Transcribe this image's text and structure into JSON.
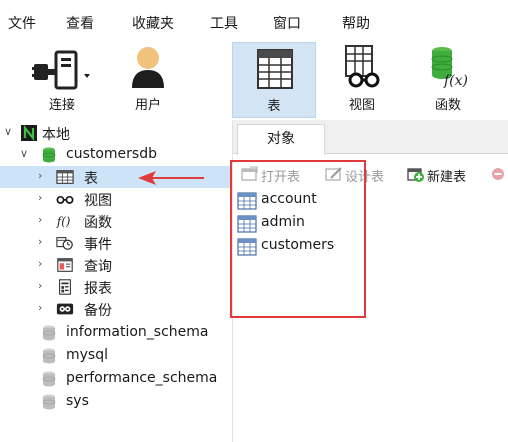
{
  "menu": {
    "items": [
      "文件",
      "查看",
      "收藏夹",
      "工具",
      "窗口",
      "帮助"
    ]
  },
  "toolbar": {
    "connect_label": "连接",
    "user_label": "用户",
    "table_label": "表",
    "view_label": "视图",
    "function_label": "函数",
    "function_icon_text": "f(x)"
  },
  "tree": {
    "root_label": "本地",
    "database_label": "customersdb",
    "children": [
      "表",
      "视图",
      "函数",
      "事件",
      "查询",
      "报表",
      "备份"
    ],
    "other_databases": [
      "information_schema",
      "mysql",
      "performance_schema",
      "sys"
    ]
  },
  "object_panel": {
    "tab_label": "对象",
    "actions": {
      "open_table": "打开表",
      "design_table": "设计表",
      "new_table": "新建表"
    },
    "tables": [
      "account",
      "admin",
      "customers"
    ]
  },
  "colors": {
    "selected_bg": "#cde3f7",
    "toolbar_selected_bg": "#d3e4f5",
    "annotation_red": "#e03a3a",
    "db_green": "#3fae3f"
  }
}
